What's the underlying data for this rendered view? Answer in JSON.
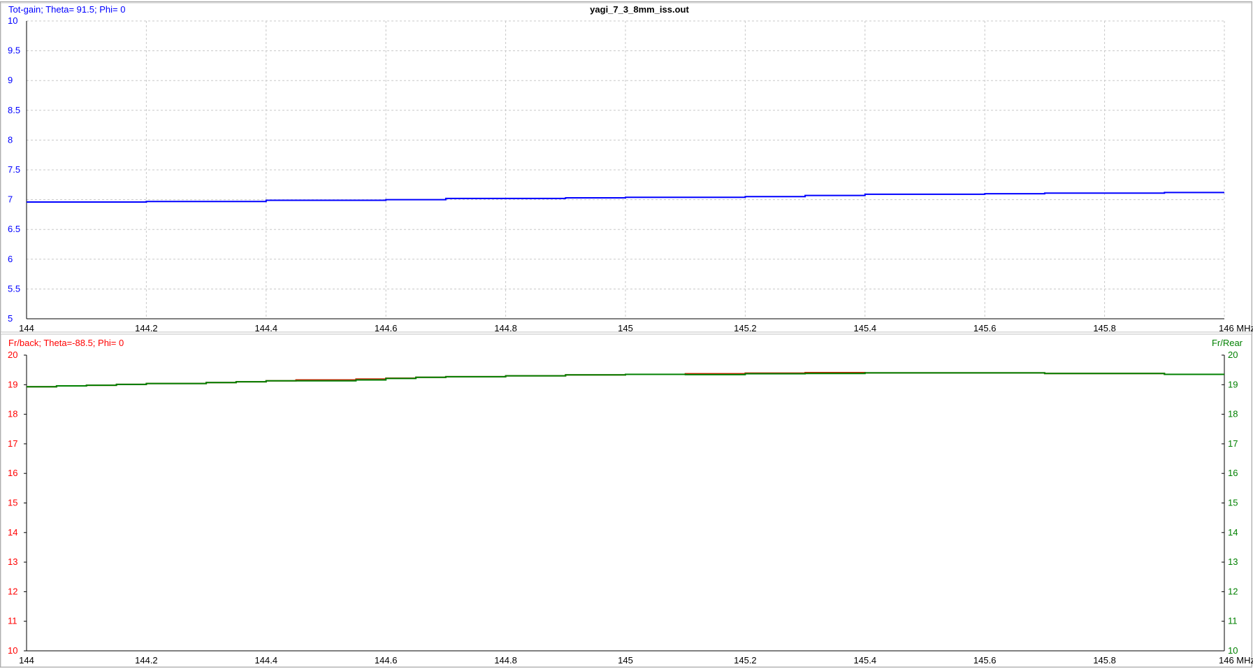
{
  "window": {
    "title": "yagi_7_3_8mm_iss.out"
  },
  "chart_data": [
    {
      "type": "line",
      "title": "",
      "ylabel": "Tot-gain; Theta= 91.5; Phi= 0",
      "xlabel": "",
      "x_unit": "MHz",
      "xlim": [
        144,
        146
      ],
      "ylim": [
        5,
        10
      ],
      "grid": true,
      "x_ticks": [
        "144",
        "144.2",
        "144.4",
        "144.6",
        "144.8",
        "145",
        "145.2",
        "145.4",
        "145.6",
        "145.8",
        "146"
      ],
      "y_ticks": [
        "5",
        "5.5",
        "6",
        "6.5",
        "7",
        "7.5",
        "8",
        "8.5",
        "9",
        "9.5",
        "10"
      ],
      "axis_color": "#0000ff",
      "series": [
        {
          "color": "#0000ff",
          "step": true,
          "x": [
            144,
            144.2,
            144.4,
            144.6,
            144.7,
            144.9,
            145,
            145.2,
            145.3,
            145.4,
            145.6,
            145.7,
            145.9,
            146
          ],
          "values": [
            6.96,
            6.97,
            6.99,
            7.0,
            7.02,
            7.03,
            7.04,
            7.05,
            7.07,
            7.09,
            7.1,
            7.11,
            7.12,
            7.14
          ]
        }
      ]
    },
    {
      "type": "line",
      "title": "",
      "ylabel": "Fr/back; Theta=-88.5; Phi= 0",
      "ylabel_right": "Fr/Rear",
      "xlabel": "",
      "x_unit": "MHz",
      "xlim": [
        144,
        146
      ],
      "ylim": [
        10,
        20
      ],
      "grid": false,
      "x_ticks": [
        "144",
        "144.2",
        "144.4",
        "144.6",
        "144.8",
        "145",
        "145.2",
        "145.4",
        "145.6",
        "145.8",
        "146"
      ],
      "y_ticks": [
        "10",
        "11",
        "12",
        "13",
        "14",
        "15",
        "16",
        "17",
        "18",
        "19",
        "20"
      ],
      "left_axis_color": "#ff0000",
      "right_axis_color": "#008000",
      "series": [
        {
          "color": "#cc2200",
          "step": true,
          "x": [
            144,
            144.05,
            144.1,
            144.15,
            144.2,
            144.3,
            144.35,
            144.4,
            144.45,
            144.55,
            144.6,
            144.65,
            144.7,
            144.8,
            144.9,
            145,
            145.1,
            145.2,
            145.3,
            145.4,
            145.7,
            145.9,
            146
          ],
          "values": [
            18.93,
            18.96,
            18.98,
            19.01,
            19.04,
            19.07,
            19.1,
            19.13,
            19.16,
            19.19,
            19.22,
            19.25,
            19.27,
            19.3,
            19.33,
            19.35,
            19.37,
            19.39,
            19.41,
            19.4,
            19.38,
            19.35,
            19.35
          ]
        },
        {
          "color": "#008000",
          "step": true,
          "x": [
            144,
            144.05,
            144.1,
            144.15,
            144.2,
            144.3,
            144.35,
            144.4,
            144.45,
            144.55,
            144.6,
            144.65,
            144.7,
            144.8,
            144.9,
            145,
            145.1,
            145.2,
            145.3,
            145.4,
            145.7,
            145.9,
            146
          ],
          "values": [
            18.93,
            18.96,
            18.98,
            19.01,
            19.04,
            19.07,
            19.1,
            19.13,
            19.13,
            19.16,
            19.21,
            19.25,
            19.27,
            19.3,
            19.33,
            19.35,
            19.34,
            19.37,
            19.38,
            19.4,
            19.38,
            19.35,
            19.35
          ]
        }
      ]
    }
  ]
}
